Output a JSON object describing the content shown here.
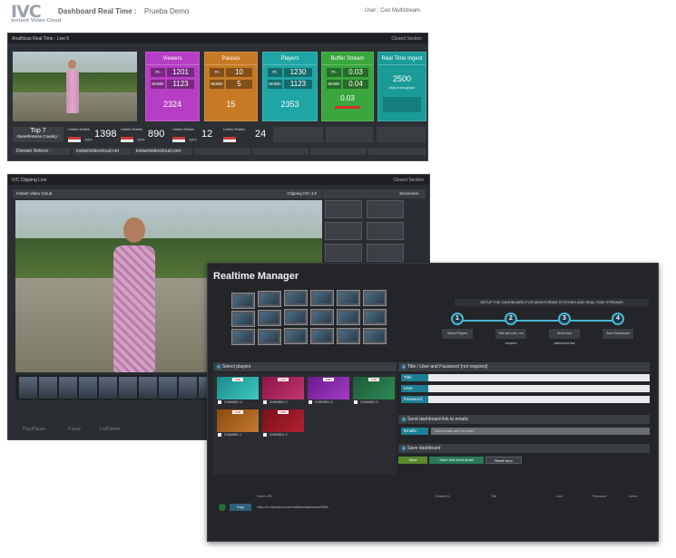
{
  "header": {
    "logo": "IVC",
    "logo_sub": "Instant Video Cloud",
    "title": "Dashboard Real Time :",
    "demo": "Prueba Demo",
    "user": "User : Ceo Multistream"
  },
  "analytics": {
    "title": "Analíticas Real Time : Live 5",
    "close": "Closed Section",
    "viewers": {
      "title": "Viewers",
      "pc_label": "Pc",
      "pc": "1201",
      "mobile_label": "Mobile",
      "mobile": "1123",
      "total": "2324"
    },
    "pauses": {
      "title": "Pauses",
      "pc_label": "Pc",
      "pc": "10",
      "mobile_label": "Mobile",
      "mobile": "5",
      "total": "15"
    },
    "players": {
      "title": "Players",
      "pc_label": "Pc",
      "pc": "1230",
      "mobile_label": "Mobile",
      "mobile": "1123",
      "total": "2353"
    },
    "buffer": {
      "title": "Buffer Stream",
      "pc_label": "Pc",
      "pc": "0.03",
      "mobile_label": "Mobile",
      "mobile": "0.04",
      "total": "0.03"
    },
    "ingest": {
      "title": "Real Time Ingest",
      "value": "2500",
      "unit": "kbps throughput"
    },
    "geo": {
      "top": "Top 7",
      "label": "Georeference Country :"
    },
    "countries": [
      {
        "name": "United States",
        "pct": "63%",
        "count": "1398"
      },
      {
        "name": "United States",
        "pct": "63%",
        "count": "890"
      },
      {
        "name": "United States",
        "pct": "63%",
        "count": "12"
      },
      {
        "name": "United States",
        "pct": "",
        "count": "24"
      }
    ],
    "domain_label": "Domain Referer :",
    "domains": [
      "instantvideocloud.net",
      "instantvideocloud.com"
    ]
  },
  "clipping": {
    "title": "IVC  Clipping Live",
    "close": "Closed Section",
    "source": "Instant Video Cloud",
    "version": "Clipping IVC 4.0",
    "sections": "Secciones",
    "controls": [
      "Play/Pause",
      "Pause",
      "Cut/Delete"
    ]
  },
  "manager": {
    "title": "Realtime Manager",
    "setup": "SETUP THE DASHBOARD FOR MONITORING SYSTEMS AND REAL TIME STREAMS",
    "steps": [
      {
        "n": "1",
        "label": "Select Players"
      },
      {
        "n": "2",
        "label": "Title and user, not required"
      },
      {
        "n": "3",
        "label": "Send User dashboard link"
      },
      {
        "n": "4",
        "label": "Save Dashboard"
      }
    ],
    "sec1": {
      "n": "1",
      "label": "Select players"
    },
    "sec2": {
      "n": "2",
      "label": "Title / User and Password (not required)"
    },
    "sec3": {
      "n": "3",
      "label": "Send dashboard link to emails"
    },
    "sec4": {
      "n": "4",
      "label": "Save dashboard"
    },
    "players": [
      "CHANNEL 4",
      "CHANNEL 3",
      "CHANNEL 6",
      "CHANNEL 5",
      "CHANNEL 1",
      "CHANNEL 2"
    ],
    "live_badge": "LIVE",
    "fields": {
      "title": "Title:",
      "user": "User:",
      "password": "Password:"
    },
    "emails_label": "Emails:",
    "emails_placeholder": "Add emails and hit enter",
    "buttons": {
      "save": "Save",
      "save_send": "Save and send email",
      "reset": "Reset form"
    },
    "table": {
      "headers": [
        "Share URL",
        "Created At",
        "Title",
        "User",
        "Password",
        "Action"
      ],
      "row": {
        "btn": "Copy",
        "url": "https://ivc.ideocloud.com/realtime/dashboard/RH5t..."
      }
    }
  }
}
